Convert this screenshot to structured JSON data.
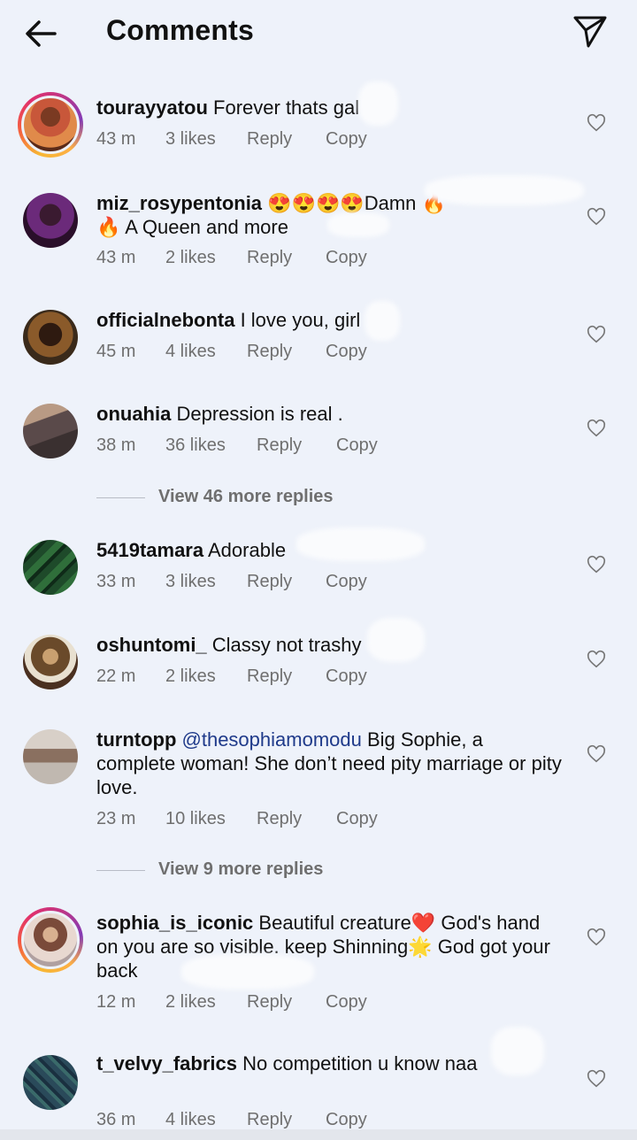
{
  "header": {
    "title": "Comments",
    "back_icon": "arrow-left-icon",
    "send_icon": "paper-plane-icon"
  },
  "comments": [
    {
      "user": "tourayyatou",
      "text": " Forever thats gal",
      "time": "43 m",
      "likes": "3 likes",
      "reply": "Reply",
      "copy": "Copy",
      "story_ring": true
    },
    {
      "user": "miz_rosypentonia",
      "text": " 😍😍😍😍Damn 🔥🔥 A Queen and more",
      "time": "43 m",
      "likes": "2 likes",
      "reply": "Reply",
      "copy": "Copy",
      "story_ring": false
    },
    {
      "user": "officialnebonta",
      "text": " I love you, girl",
      "time": "45 m",
      "likes": "4 likes",
      "reply": "Reply",
      "copy": "Copy",
      "story_ring": false
    },
    {
      "user": "onuahia",
      "text": " Depression is real .",
      "time": "38 m",
      "likes": "36 likes",
      "reply": "Reply",
      "copy": "Copy",
      "story_ring": false,
      "view_more": "View 46 more replies"
    },
    {
      "user": "5419tamara",
      "text": " Adorable",
      "time": "33 m",
      "likes": "3 likes",
      "reply": "Reply",
      "copy": "Copy",
      "story_ring": false
    },
    {
      "user": "oshuntomi_",
      "text": " Classy not trashy",
      "time": "22 m",
      "likes": "2 likes",
      "reply": "Reply",
      "copy": "Copy",
      "story_ring": false
    },
    {
      "user": "turntopp",
      "mention": " @thesophiamomodu",
      "text": " Big Sophie, a complete woman! She don’t need pity marriage or pity love.",
      "time": "23 m",
      "likes": "10 likes",
      "reply": "Reply",
      "copy": "Copy",
      "story_ring": false,
      "view_more": "View 9 more replies"
    },
    {
      "user": "sophia_is_iconic",
      "text": " Beautiful creature❤️ God's hand on you are so visible. keep Shinning🌟 God got your back",
      "time": "12 m",
      "likes": "2 likes",
      "reply": "Reply",
      "copy": "Copy",
      "story_ring": true
    },
    {
      "user": "t_velvy_fabrics",
      "text": " No competition u know naa",
      "time": "36 m",
      "likes": "4 likes",
      "reply": "Reply",
      "copy": "Copy",
      "story_ring": false
    }
  ],
  "colors": {
    "background": "#eef2fa",
    "meta_text": "#6f6f6f",
    "mention": "#1f3a8a"
  }
}
